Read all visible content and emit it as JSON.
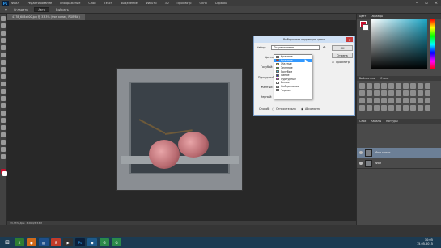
{
  "menubar": {
    "logo": "Ps",
    "items": [
      "Файл",
      "Редактирование",
      "Изображение",
      "Слои",
      "Текст",
      "Выделение",
      "Фильтр",
      "3D",
      "Просмотр",
      "Окно",
      "Справка"
    ]
  },
  "optionsbar": {
    "items": [
      "Сгладить",
      "Авто",
      "Выбрать"
    ]
  },
  "document": {
    "tab": "4178_608x000.jpg @ 33,3% (Фон копия, RGB/8#)",
    "status": "33,33%  Док: 3,26M/6,53M"
  },
  "right_panel": {
    "color_tabs": [
      "Цвет",
      "Образцы"
    ],
    "adjust_tabs": [
      "Библиотеки",
      "Стили"
    ],
    "layers_tabs": [
      "Слои",
      "Каналы",
      "Контуры"
    ],
    "layers": [
      {
        "name": "Фон копия",
        "active": true
      },
      {
        "name": "Фон",
        "active": false
      }
    ]
  },
  "dialog": {
    "title": "Выборочная коррекция цвета",
    "preset_label": "Набор:",
    "preset_value": "По умолчанию",
    "ok": "OK",
    "cancel": "Отмена",
    "preview": "Просмотр",
    "colors_label": "Цвета:",
    "cyan_label": "Голубой:",
    "magenta_label": "Пурпурный:",
    "yellow_label": "Желтый:",
    "black_label": "Черный:",
    "method_label": "Способ:",
    "relative": "Относительно",
    "absolute": "Абсолютно",
    "color_options": [
      {
        "name": "Красные",
        "color": "#e0201b"
      },
      {
        "name": "Красные",
        "color": "#e0201b",
        "highlighted": true
      },
      {
        "name": "Желтые",
        "color": "#f5e11a"
      },
      {
        "name": "Зеленые",
        "color": "#3cb43c"
      },
      {
        "name": "Голубые",
        "color": "#35c7e6"
      },
      {
        "name": "Синие",
        "color": "#2033d1"
      },
      {
        "name": "Пурпурные",
        "color": "#d12fd1"
      },
      {
        "name": "Белые",
        "color": "#ffffff"
      },
      {
        "name": "Нейтральные",
        "color": "#9a9a9a"
      },
      {
        "name": "Черные",
        "color": "#000000"
      }
    ]
  },
  "taskbar": {
    "time": "10:05",
    "date": "15.05.2015"
  },
  "colors": {
    "foreground": "#c8102e",
    "background": "#ffffff"
  }
}
